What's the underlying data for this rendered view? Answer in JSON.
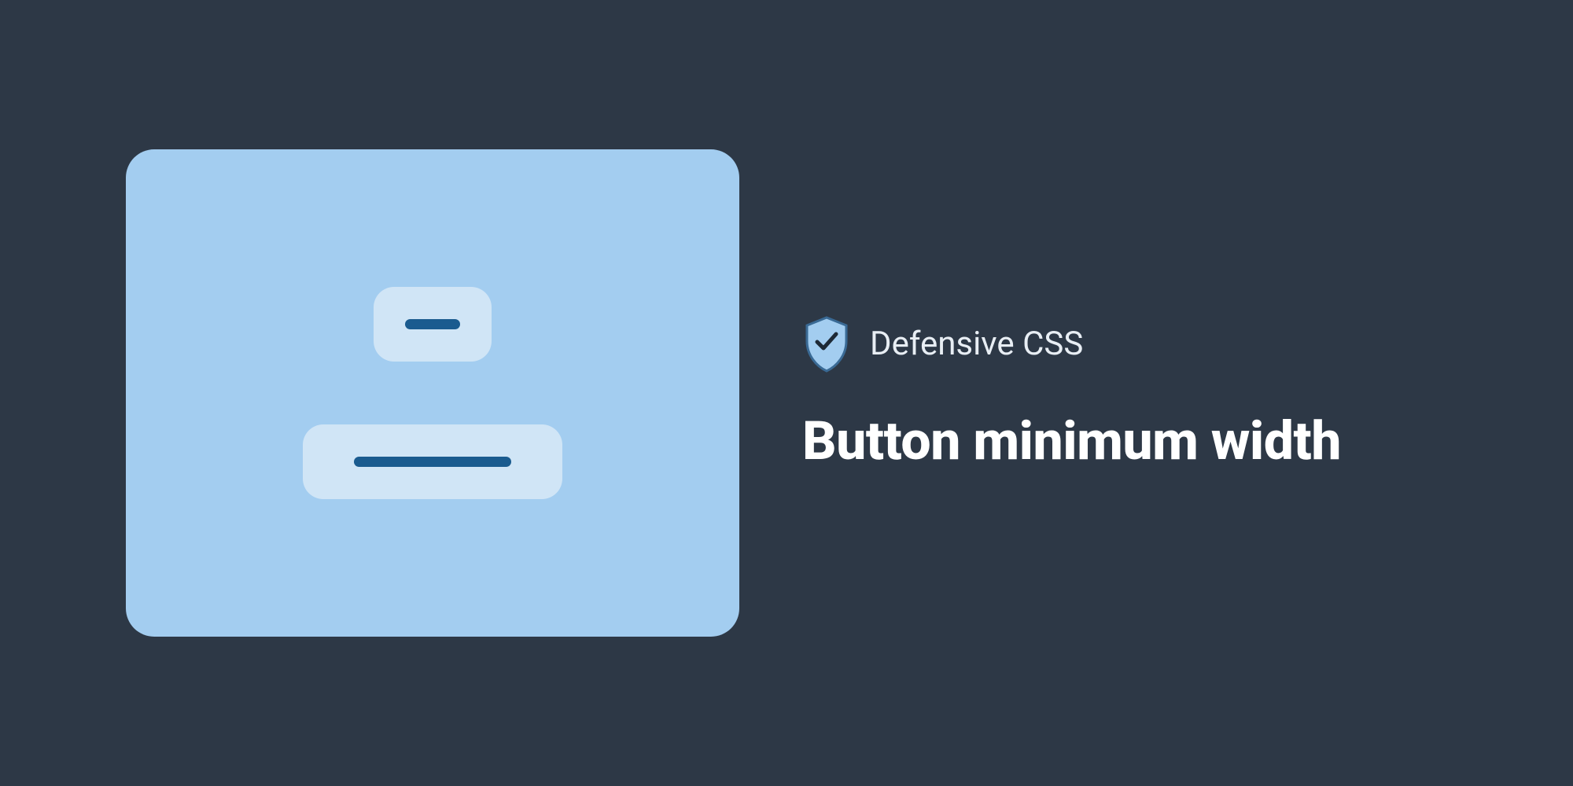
{
  "brand": {
    "label": "Defensive CSS"
  },
  "title": "Button minimum width",
  "colors": {
    "background": "#2d3846",
    "card": "#a3cdf0",
    "button": "#d0e5f6",
    "bar": "#1a5b8f",
    "text_primary": "#ffffff",
    "text_secondary": "#e8eef4"
  }
}
